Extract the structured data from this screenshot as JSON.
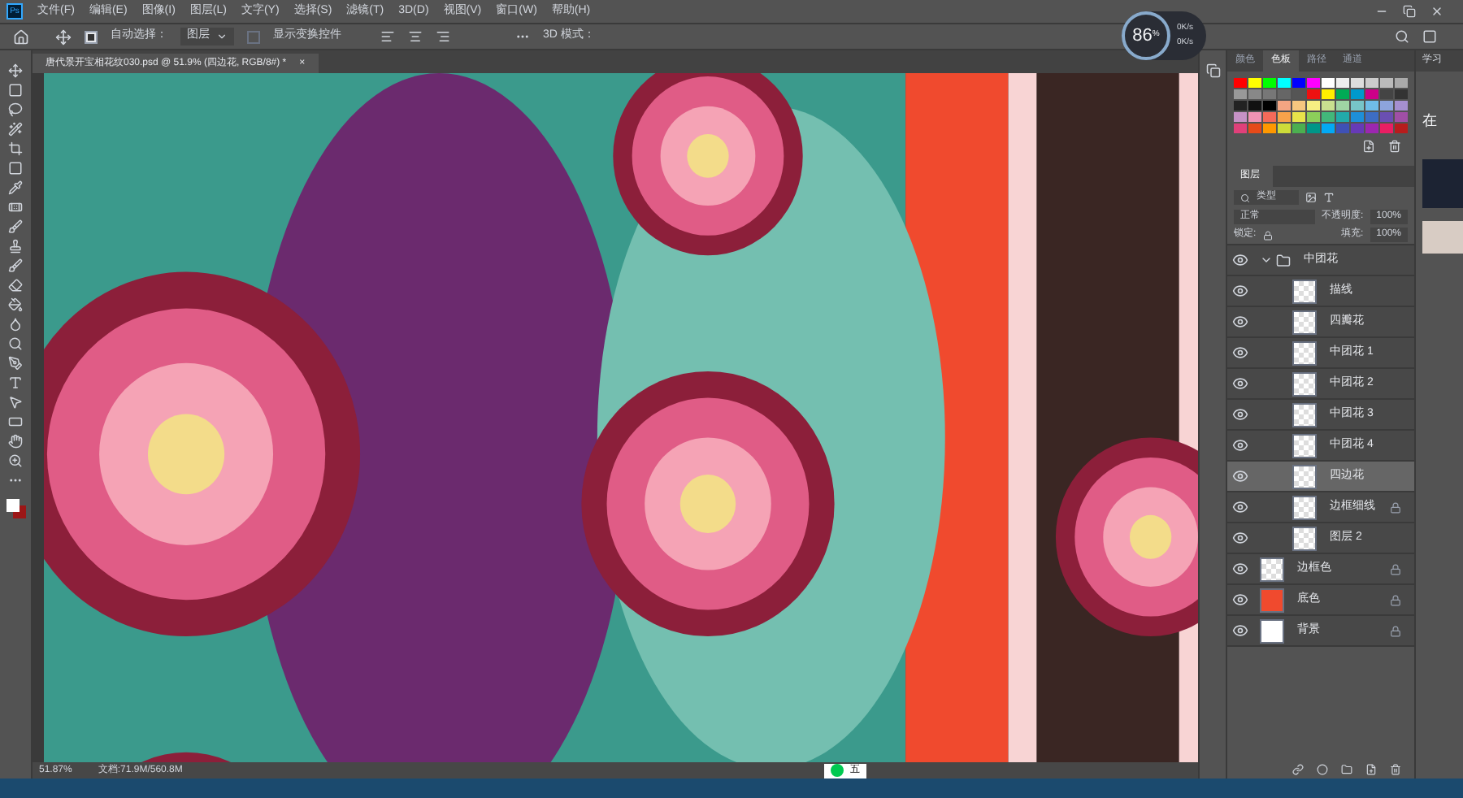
{
  "app": {
    "logo": "Ps"
  },
  "menu": [
    "文件(F)",
    "编辑(E)",
    "图像(I)",
    "图层(L)",
    "文字(Y)",
    "选择(S)",
    "滤镜(T)",
    "3D(D)",
    "视图(V)",
    "窗口(W)",
    "帮助(H)"
  ],
  "options_bar": {
    "auto_select": {
      "label": "自动选择：",
      "checked": true
    },
    "auto_select_target": "图层",
    "show_transform": {
      "label": "显示变换控件",
      "checked": false
    },
    "mode_3d": "3D 模式："
  },
  "monitor": {
    "percent": "86",
    "unit": "%",
    "upload": "0K/s",
    "download": "0K/s"
  },
  "document_tab": {
    "title": "唐代景开宝相花纹030.psd @ 51.9% (四边花, RGB/8#) *",
    "close": "×"
  },
  "status_bar": {
    "zoom": "51.87%",
    "doc": "文档:71.9M/560.8M"
  },
  "ime_bar": {
    "mode": "五"
  },
  "swatch_panel": {
    "tabs": [
      {
        "label": "颜色",
        "selected": false
      },
      {
        "label": "色板",
        "selected": true
      },
      {
        "label": "路径",
        "selected": false
      },
      {
        "label": "通道",
        "selected": false
      }
    ]
  },
  "learn_panel": {
    "tab": "学习",
    "text": "在"
  },
  "layers_panel": {
    "title": "图层",
    "filter": "类型",
    "blend_mode": "正常",
    "opacity_label": "不透明度:",
    "opacity": "100%",
    "lock_label": "锁定:",
    "fill_label": "填充:",
    "fill": "100%",
    "layers": [
      {
        "name": "中团花",
        "kind": "group",
        "expanded": true,
        "visible": true,
        "selected": false,
        "locked": false,
        "children": [
          {
            "name": "描线",
            "kind": "layer",
            "visible": true,
            "selected": false,
            "locked": false
          },
          {
            "name": "四瓣花",
            "kind": "layer",
            "visible": true,
            "selected": false,
            "locked": false
          },
          {
            "name": "中团花 1",
            "kind": "layer",
            "visible": true,
            "selected": false,
            "locked": false
          },
          {
            "name": "中团花 2",
            "kind": "layer",
            "visible": true,
            "selected": false,
            "locked": false
          },
          {
            "name": "中团花 3",
            "kind": "layer",
            "visible": true,
            "selected": false,
            "locked": false
          },
          {
            "name": "中团花 4",
            "kind": "layer",
            "visible": true,
            "selected": false,
            "locked": false
          },
          {
            "name": "四边花",
            "kind": "layer",
            "visible": true,
            "selected": true,
            "locked": false
          },
          {
            "name": "边框细线",
            "kind": "layer",
            "visible": true,
            "selected": false,
            "locked": true
          },
          {
            "name": "图层 2",
            "kind": "layer",
            "visible": true,
            "selected": false,
            "locked": false
          }
        ]
      },
      {
        "name": "边框色",
        "kind": "layer",
        "visible": true,
        "selected": false,
        "locked": true
      },
      {
        "name": "底色",
        "kind": "fill",
        "color": "#f04a2e",
        "visible": true,
        "selected": false,
        "locked": true
      },
      {
        "name": "背景",
        "kind": "fill",
        "color": "#ffffff",
        "visible": true,
        "selected": false,
        "locked": true
      }
    ]
  }
}
